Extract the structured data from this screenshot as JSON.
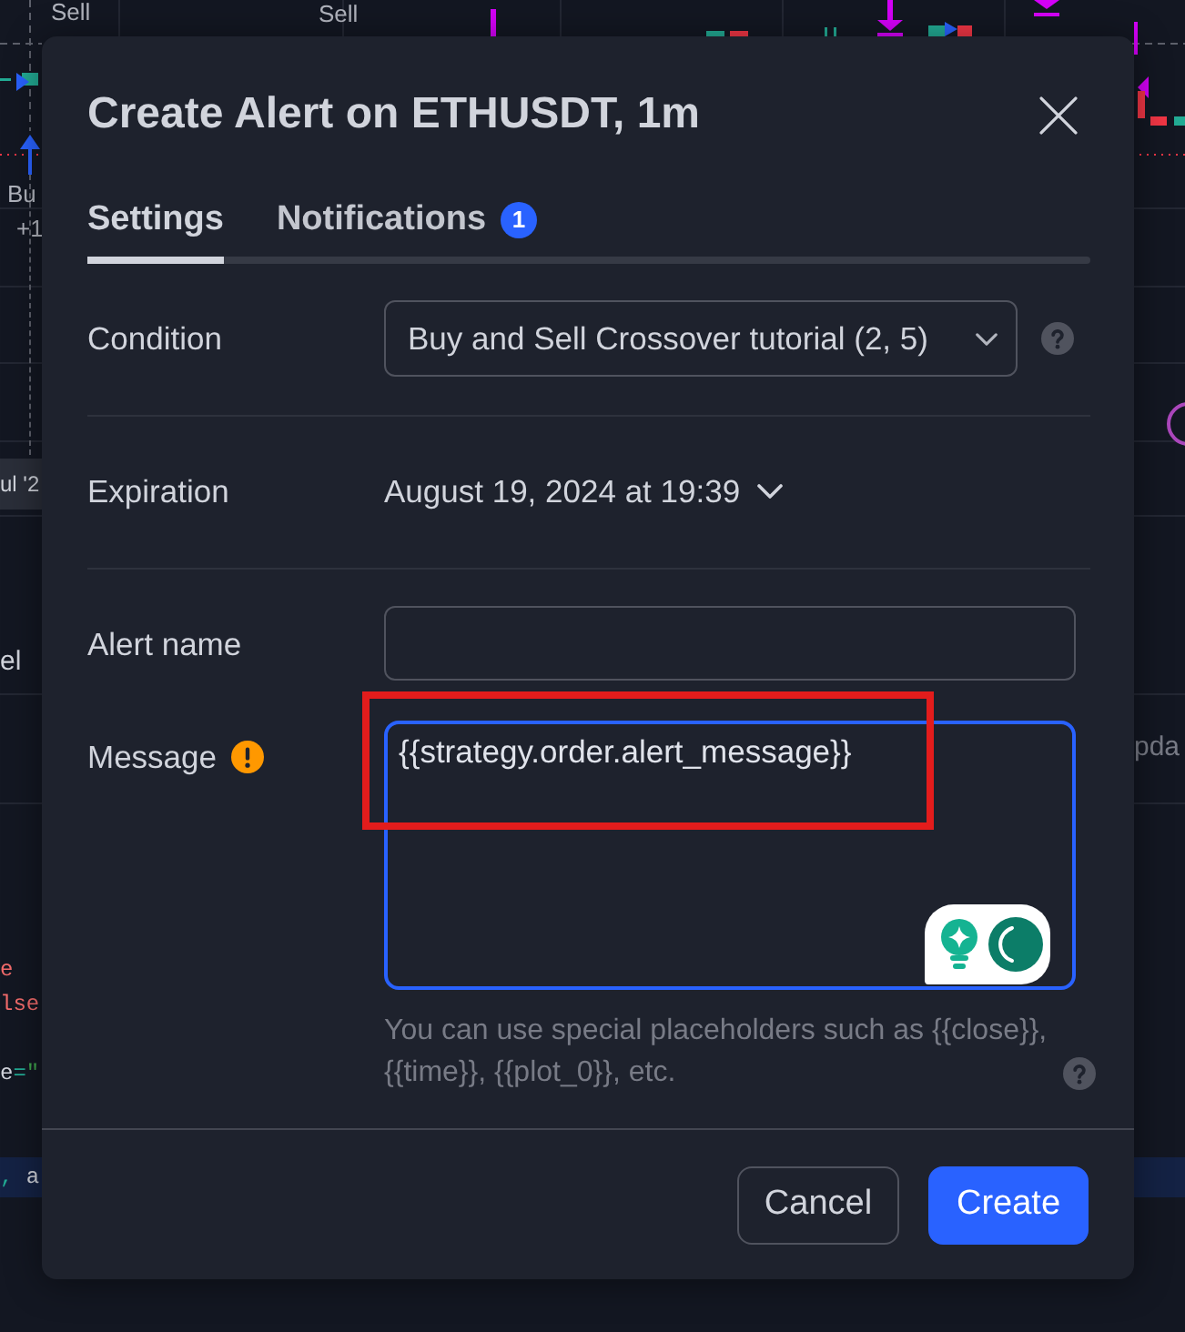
{
  "background": {
    "chart_labels": [
      "Sell",
      "Sell",
      "Bu",
      "+1"
    ],
    "time_label": "ul '2",
    "panel_labels": [
      "el",
      "pda"
    ],
    "code_lines": [
      {
        "highlighted": false,
        "tokens": [
          {
            "kind": "keyword",
            "text": "e"
          }
        ]
      },
      {
        "highlighted": false,
        "tokens": [
          {
            "kind": "keyword",
            "text": "lse"
          }
        ]
      },
      {
        "highlighted": false,
        "tokens": [
          {
            "kind": "name",
            "text": "e"
          },
          {
            "kind": "operator",
            "text": "="
          },
          {
            "kind": "string",
            "text": "\""
          }
        ]
      },
      {
        "highlighted": true,
        "tokens": [
          {
            "kind": "operator",
            "text": ","
          },
          {
            "kind": "name",
            "text": " a"
          }
        ]
      }
    ]
  },
  "dialog": {
    "title": "Create Alert on ETHUSDT, 1m",
    "tabs": [
      {
        "label": "Settings",
        "selected": true
      },
      {
        "label": "Notifications",
        "selected": false,
        "badge": "1"
      }
    ],
    "fields": [
      {
        "kind": "select",
        "label": "Condition",
        "value": "Buy and Sell Crossover tutorial (2, 5)"
      },
      {
        "kind": "dropdown",
        "label": "Expiration",
        "value": "August 19, 2024 at 19:39"
      },
      {
        "kind": "input",
        "label": "Alert name"
      },
      {
        "kind": "textarea",
        "label": "Message",
        "warning": true,
        "focused": true,
        "value": "{{strategy.order.alert_message}}",
        "hint": "You can use special placeholders such as {{close}}, {{time}}, {{plot_0}}, etc."
      }
    ],
    "buttons": [
      {
        "kind": "secondary",
        "label": "Cancel"
      },
      {
        "kind": "primary",
        "label": "Create"
      }
    ]
  },
  "annotation": {
    "kind": "frame"
  }
}
